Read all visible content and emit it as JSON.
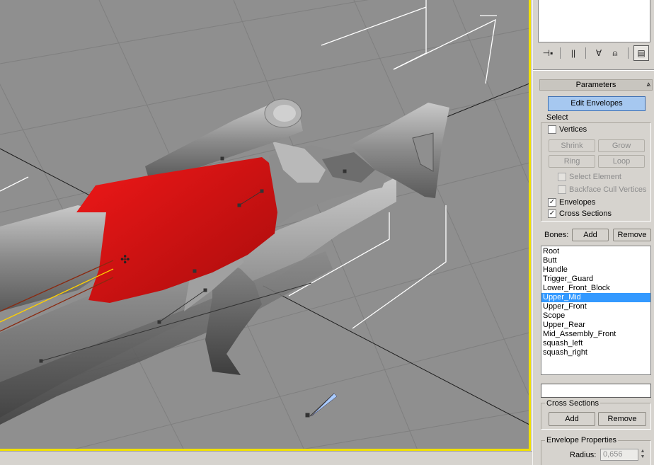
{
  "panel": {
    "rollout_title": "Parameters",
    "edit_envelopes": "Edit Envelopes",
    "select": {
      "title": "Select",
      "vertices": {
        "label": "Vertices",
        "checked": false
      },
      "shrink": "Shrink",
      "grow": "Grow",
      "ring": "Ring",
      "loop": "Loop",
      "select_element": {
        "label": "Select Element",
        "checked": false
      },
      "backface_cull": {
        "label": "Backface Cull Vertices",
        "checked": false
      },
      "envelopes": {
        "label": "Envelopes",
        "checked": true
      },
      "cross_sections": {
        "label": "Cross Sections",
        "checked": true
      }
    },
    "bones": {
      "label": "Bones:",
      "add": "Add",
      "remove": "Remove",
      "items": [
        "Root",
        "Butt",
        "Handle",
        "Trigger_Guard",
        "Lower_Front_Block",
        "Upper_Mid",
        "Upper_Front",
        "Scope",
        "Upper_Rear",
        "Mid_Assembly_Front",
        "squash_left",
        "squash_right"
      ],
      "selected": "Upper_Mid"
    },
    "cross_sections_group": {
      "title": "Cross Sections",
      "add": "Add",
      "remove": "Remove",
      "input_value": ""
    },
    "envelope_properties": {
      "title": "Envelope Properties",
      "radius_label": "Radius:",
      "radius_value": "0,656"
    },
    "toolbar_icons": [
      "pin-stack-icon",
      "show-end-result-icon",
      "make-unique-icon",
      "remove-modifier-icon",
      "configure-modifier-sets-icon"
    ]
  },
  "colors": {
    "viewport_bg": "#8f8f8f",
    "selected_envelope": "#cc1010",
    "active_border": "#f0e000",
    "selection_highlight": "#3399ff",
    "button_active": "#a6c8f0"
  }
}
